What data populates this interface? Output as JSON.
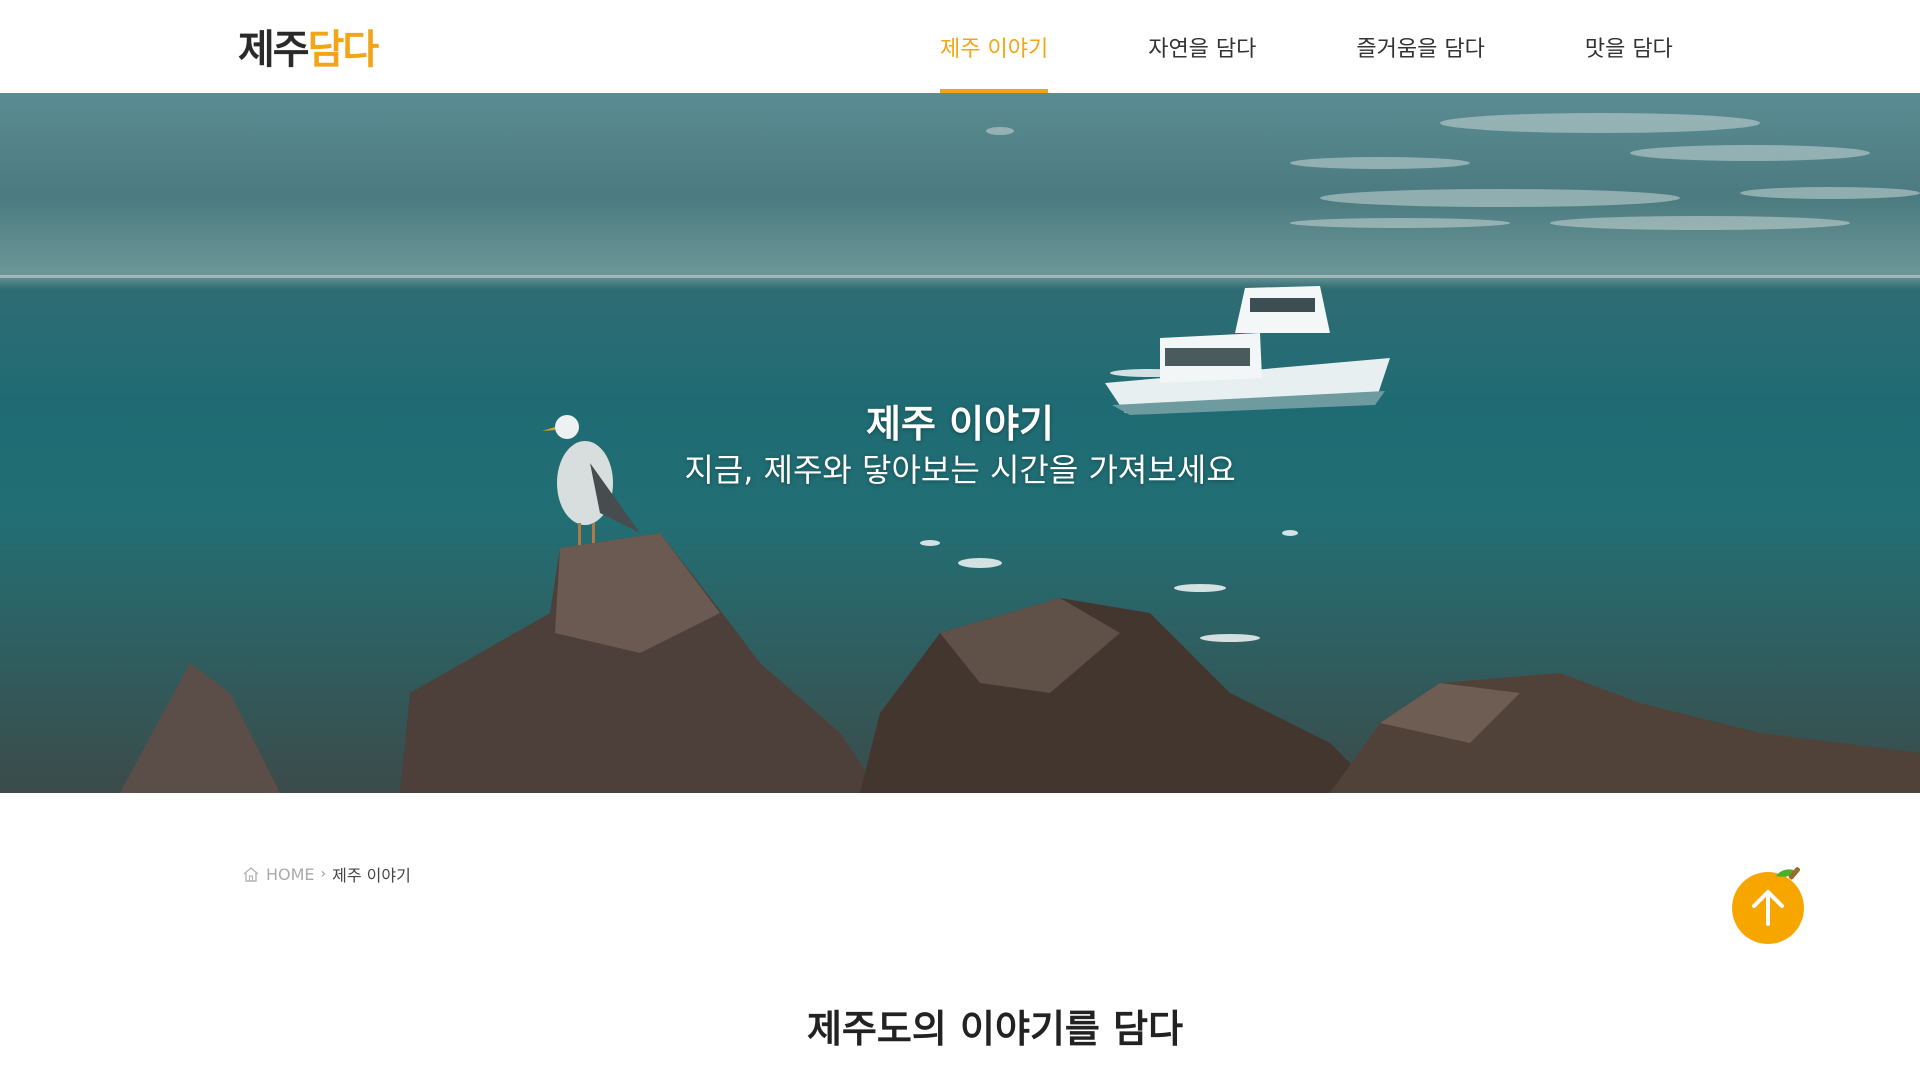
{
  "header": {
    "logo_text_1": "제주",
    "logo_text_2": "담다",
    "nav": [
      {
        "label": "제주 이야기",
        "active": true
      },
      {
        "label": "자연을 담다",
        "active": false
      },
      {
        "label": "즐거움을 담다",
        "active": false
      },
      {
        "label": "맛을 담다",
        "active": false
      }
    ]
  },
  "hero": {
    "title": "제주 이야기",
    "subtitle": "지금, 제주와 닿아보는 시간을 가져보세요"
  },
  "breadcrumb": {
    "home_icon": "home-icon",
    "home": "HOME",
    "separator": "›",
    "current": "제주 이야기"
  },
  "top_button": {
    "icon": "arrow-up-icon",
    "color": "#f7a600"
  },
  "section": {
    "title": "제주도의 이야기를 담다"
  },
  "colors": {
    "accent": "#f2a516"
  }
}
